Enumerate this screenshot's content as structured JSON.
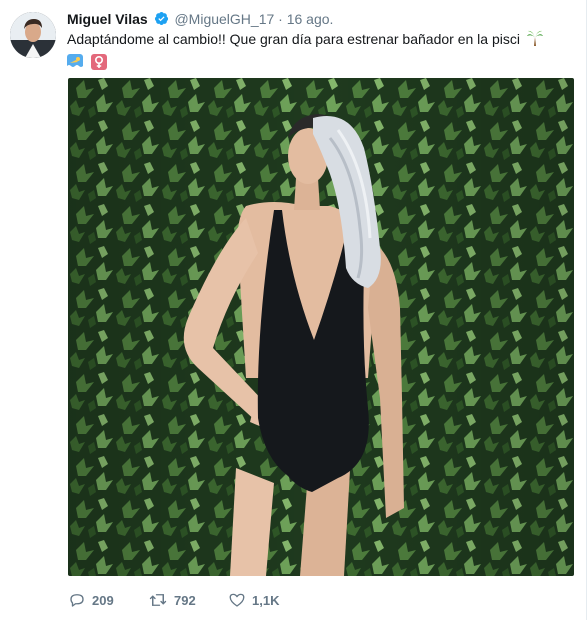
{
  "tweet": {
    "author_name": "Miguel Vilas",
    "handle": "@MiguelGH_17",
    "separator": "·",
    "date": "16 ago.",
    "text": "Adaptándome al cambio!! Que gran día para estrenar bañador en la pisci",
    "emojis": [
      "palm-tree-icon",
      "swimmer-icon",
      "female-sign-icon"
    ]
  },
  "actions": {
    "replies": "209",
    "retweets": "792",
    "likes": "1,1K"
  },
  "colors": {
    "verified": "#1da1f2",
    "secondary_text": "#657786",
    "foliage_dark": "#1f3a1e",
    "foliage_light": "#6fa35a",
    "swimsuit": "#15181c"
  }
}
